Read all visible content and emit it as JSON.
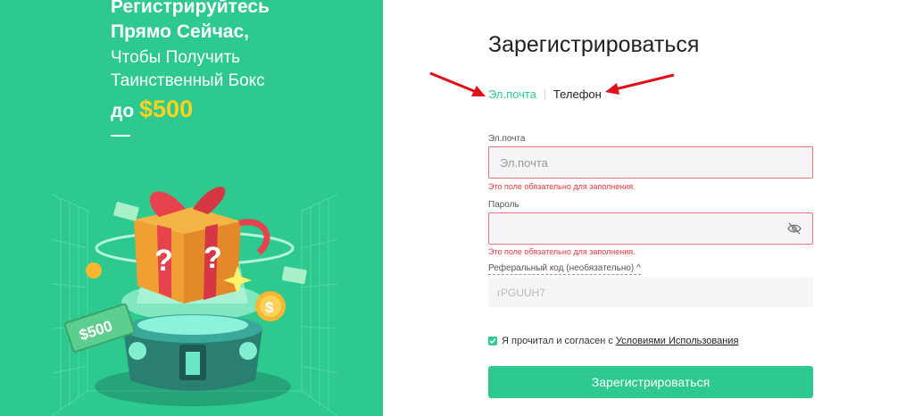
{
  "promo": {
    "line1": "Регистрируйтесь",
    "line2": "Прямо Сейчас,",
    "line3": "Чтобы Получить",
    "line4": "Таинственный Бокс",
    "line5_prefix": "до",
    "line5_amount": "$500",
    "banknote_label": "$500",
    "gift_mark": "?"
  },
  "form": {
    "title": "Зарегистрироваться",
    "tabs": [
      "Эл.почта",
      "Телефон"
    ],
    "active_tab": "Эл.почта",
    "email": {
      "label": "Эл.почта",
      "placeholder": "Эл.почта",
      "value": "",
      "error": "Это поле обязательно для заполнения."
    },
    "password": {
      "label": "Пароль",
      "placeholder": "",
      "value": "",
      "error": "Это поле обязательно для заполнения."
    },
    "referral": {
      "label": "Реферальный код (необязательно)",
      "value": "rPGUUH7"
    },
    "agreement": {
      "checked": true,
      "text": "Я прочитал и согласен с",
      "link": "Условиями Использования"
    },
    "submit_label": "Зарегистрироваться"
  },
  "colors": {
    "brand": "#2dc98f",
    "error": "#e5353b",
    "promo_amount": "#ffd21f",
    "annotation_arrow": "#e0101a"
  }
}
